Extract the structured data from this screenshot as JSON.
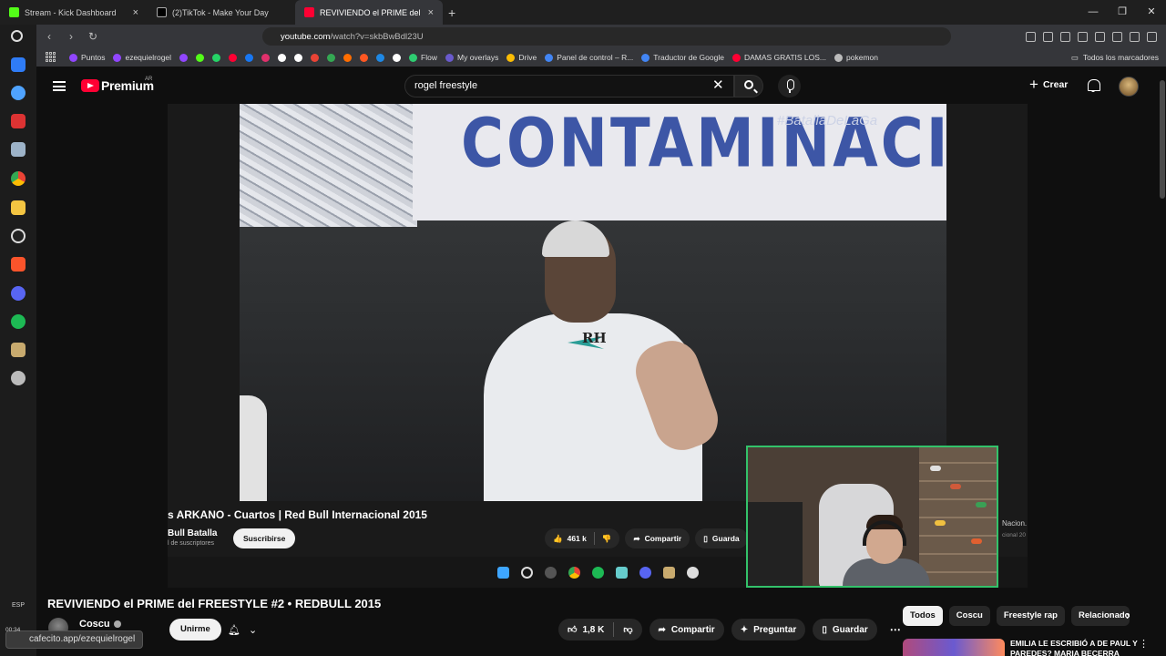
{
  "browser": {
    "tabs": [
      {
        "label": "Stream - Kick Dashboard",
        "color": "#53fc18"
      },
      {
        "label": "(2)TikTok - Make Your Day",
        "color": "#ffffff"
      },
      {
        "label": "REVIVIENDO el PRIME del FRE",
        "color": "#ff0033"
      }
    ],
    "url_domain": "youtube.com",
    "url_path": "/watch?v=skbBwBdl23U",
    "bookmarks": [
      {
        "label": "Puntos",
        "color": "#9146ff"
      },
      {
        "label": "ezequielrogel",
        "color": "#9146ff"
      },
      {
        "label": "",
        "color": "#9146ff"
      },
      {
        "label": "",
        "color": "#53fc18"
      },
      {
        "label": "",
        "color": "#25d366"
      },
      {
        "label": "",
        "color": "#ff0033"
      },
      {
        "label": "",
        "color": "#1877f2"
      },
      {
        "label": "",
        "color": "#e1306c"
      },
      {
        "label": "",
        "color": "#ffffff"
      },
      {
        "label": "",
        "color": "#ffffff"
      },
      {
        "label": "",
        "color": "#ea4335"
      },
      {
        "label": "",
        "color": "#34a853"
      },
      {
        "label": "",
        "color": "#ff6d00"
      },
      {
        "label": "",
        "color": "#ff5722"
      },
      {
        "label": "",
        "color": "#1e88e5"
      },
      {
        "label": "",
        "color": "#ffffff"
      },
      {
        "label": "Flow",
        "color": "#2ecc71"
      },
      {
        "label": "My overlays",
        "color": "#6a5acd"
      },
      {
        "label": "Drive",
        "color": "#fbbc04"
      },
      {
        "label": "Panel de control – R...",
        "color": "#4285f4"
      },
      {
        "label": "Traductor de Google",
        "color": "#4285f4"
      },
      {
        "label": "DAMAS GRATIS LOS...",
        "color": "#ff0033"
      },
      {
        "label": "pokemon",
        "color": "#bbbbbb"
      }
    ],
    "bookmarks_all": "Todos los marcadores"
  },
  "dock": {
    "lang": "ESP",
    "time": "00:34"
  },
  "youtube": {
    "brand": "Premium",
    "region": "AR",
    "search_value": "rogel freestyle",
    "create_label": "Crear"
  },
  "video_overlay": {
    "banner_text": "CONTAMINACI",
    "banner_tag": "#BatallaDeLaGa",
    "shirt_text": "RH",
    "embedded_title": "s ARKANO - Cuartos | Red Bull Internacional 2015",
    "embedded_channel": "Bull Batalla",
    "embedded_subs": "l de suscriptores",
    "embedded_subscribe": "Suscribirse",
    "embedded_likes": "461 k",
    "embedded_share": "Compartir",
    "embedded_save": "Guarda",
    "embedded_side_1": "Nacion.",
    "embedded_side_2": "cional 20"
  },
  "video": {
    "title": "REVIVIENDO el PRIME del FREESTYLE #2 • REDBULL 2015",
    "channel": "Coscu",
    "join_label": "Unirme",
    "likes": "1,8 K",
    "share_label": "Compartir",
    "ask_label": "Preguntar",
    "save_label": "Guardar"
  },
  "chips": [
    "Todos",
    "Coscu",
    "Freestyle rap",
    "Relacionados"
  ],
  "recommendation": {
    "title": "EMILIA LE ESCRIBIÓ A DE PAUL Y PAREDES? MARIA BECERRA"
  },
  "status_link": "cafecito.app/ezequielrogel",
  "colors": {
    "yt_red": "#ff0033",
    "webcam_border": "#33c26a",
    "banner_text": "#3d56a6"
  }
}
